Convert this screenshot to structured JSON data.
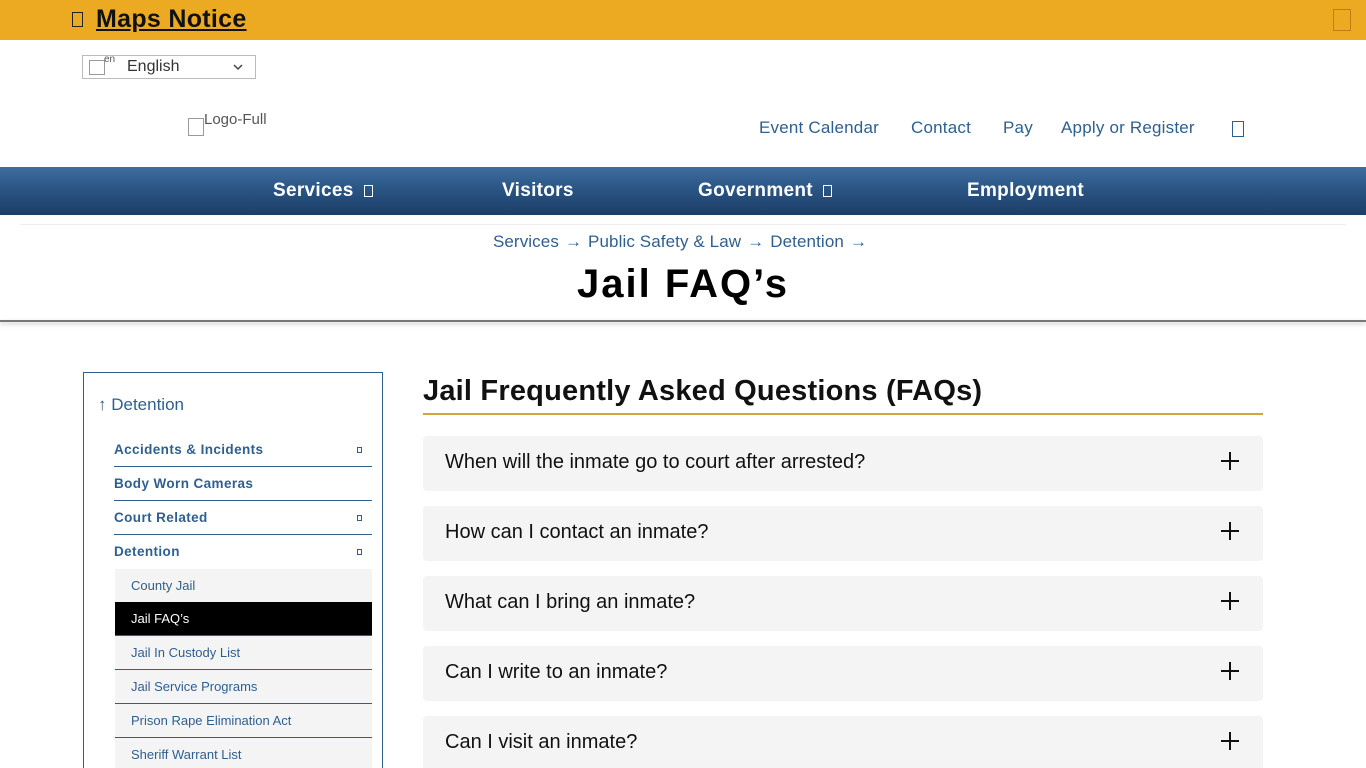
{
  "notice": {
    "title": "Maps Notice",
    "icon": "warning-icon",
    "close_icon": "close-icon"
  },
  "language": {
    "flag_alt": "en",
    "label": "English"
  },
  "logo": {
    "alt": "Logo-Full"
  },
  "utility_nav": {
    "items": [
      {
        "label": "Event Calendar"
      },
      {
        "label": "Contact"
      },
      {
        "label": "Pay"
      },
      {
        "label": "Apply or Register"
      }
    ],
    "search_icon": "search-icon"
  },
  "main_nav": {
    "items": [
      {
        "label": "Services",
        "has_submenu": true
      },
      {
        "label": "Visitors",
        "has_submenu": false
      },
      {
        "label": "Government",
        "has_submenu": true
      },
      {
        "label": "Employment",
        "has_submenu": false
      }
    ]
  },
  "breadcrumb": {
    "items": [
      {
        "label": "Services"
      },
      {
        "label": "Public Safety & Law"
      },
      {
        "label": "Detention"
      }
    ],
    "separator": "→"
  },
  "page": {
    "title": "Jail FAQ’s"
  },
  "sidebar": {
    "up_label": "↑ Detention",
    "items": [
      {
        "label": "Accidents & Incidents",
        "expandable": true
      },
      {
        "label": "Body Worn Cameras",
        "expandable": false
      },
      {
        "label": "Court Related",
        "expandable": true
      },
      {
        "label": "Detention",
        "expandable": true
      }
    ],
    "subitems": [
      {
        "label": "County Jail",
        "active": false
      },
      {
        "label": "Jail FAQ’s",
        "active": true
      },
      {
        "label": "Jail In Custody List",
        "active": false
      },
      {
        "label": "Jail Service Programs",
        "active": false
      },
      {
        "label": "Prison Rape Elimination Act",
        "active": false
      },
      {
        "label": "Sheriff Warrant List",
        "active": false
      }
    ]
  },
  "content": {
    "title": "Jail Frequently Asked Questions (FAQs)",
    "faqs": [
      {
        "question": "When will the inmate go to court after arrested?"
      },
      {
        "question": "How can I contact an inmate?"
      },
      {
        "question": "What can I bring an inmate?"
      },
      {
        "question": "Can I write to an inmate?"
      },
      {
        "question": "Can I visit an inmate?"
      }
    ]
  },
  "colors": {
    "notice_bg": "#ebaa22",
    "nav_bg": "#2a5585",
    "link": "#2f5f8f",
    "accent_rule": "#d4a63a",
    "faq_bg": "#f4f4f4",
    "active_bg": "#000000"
  }
}
